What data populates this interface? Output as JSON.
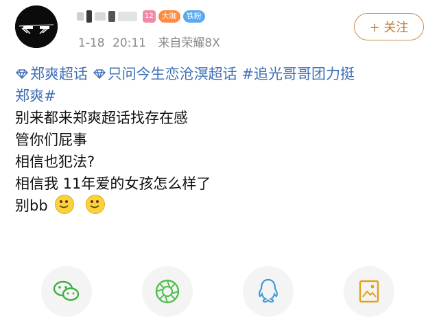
{
  "post": {
    "user": {
      "badge_level": "12",
      "badge_bigv": "大咖",
      "badge_fan": "铁粉"
    },
    "meta": {
      "date": "1-18",
      "time": "20:11",
      "source": "来自荣耀8X"
    },
    "follow_label": "+ 关注",
    "content": {
      "topics_line1": [
        "郑爽超话",
        "只问今生恋沧溟超话",
        "#追光哥哥团力挺"
      ],
      "topics_line2": "郑爽#",
      "lines": [
        "别来都来郑爽超话找存在感",
        "管你们屁事",
        "相信也犯法?",
        "相信我 11年爱的女孩怎么样了",
        "别bb"
      ],
      "emojis": [
        "smile-emoji",
        "smile-emoji"
      ]
    },
    "share_buttons": [
      "wechat-icon",
      "moments-icon",
      "qq-icon",
      "save-image-icon"
    ],
    "colors": {
      "topic": "#3f6fb5",
      "follow": "#c07a3a",
      "meta": "#8a8a8a"
    }
  }
}
